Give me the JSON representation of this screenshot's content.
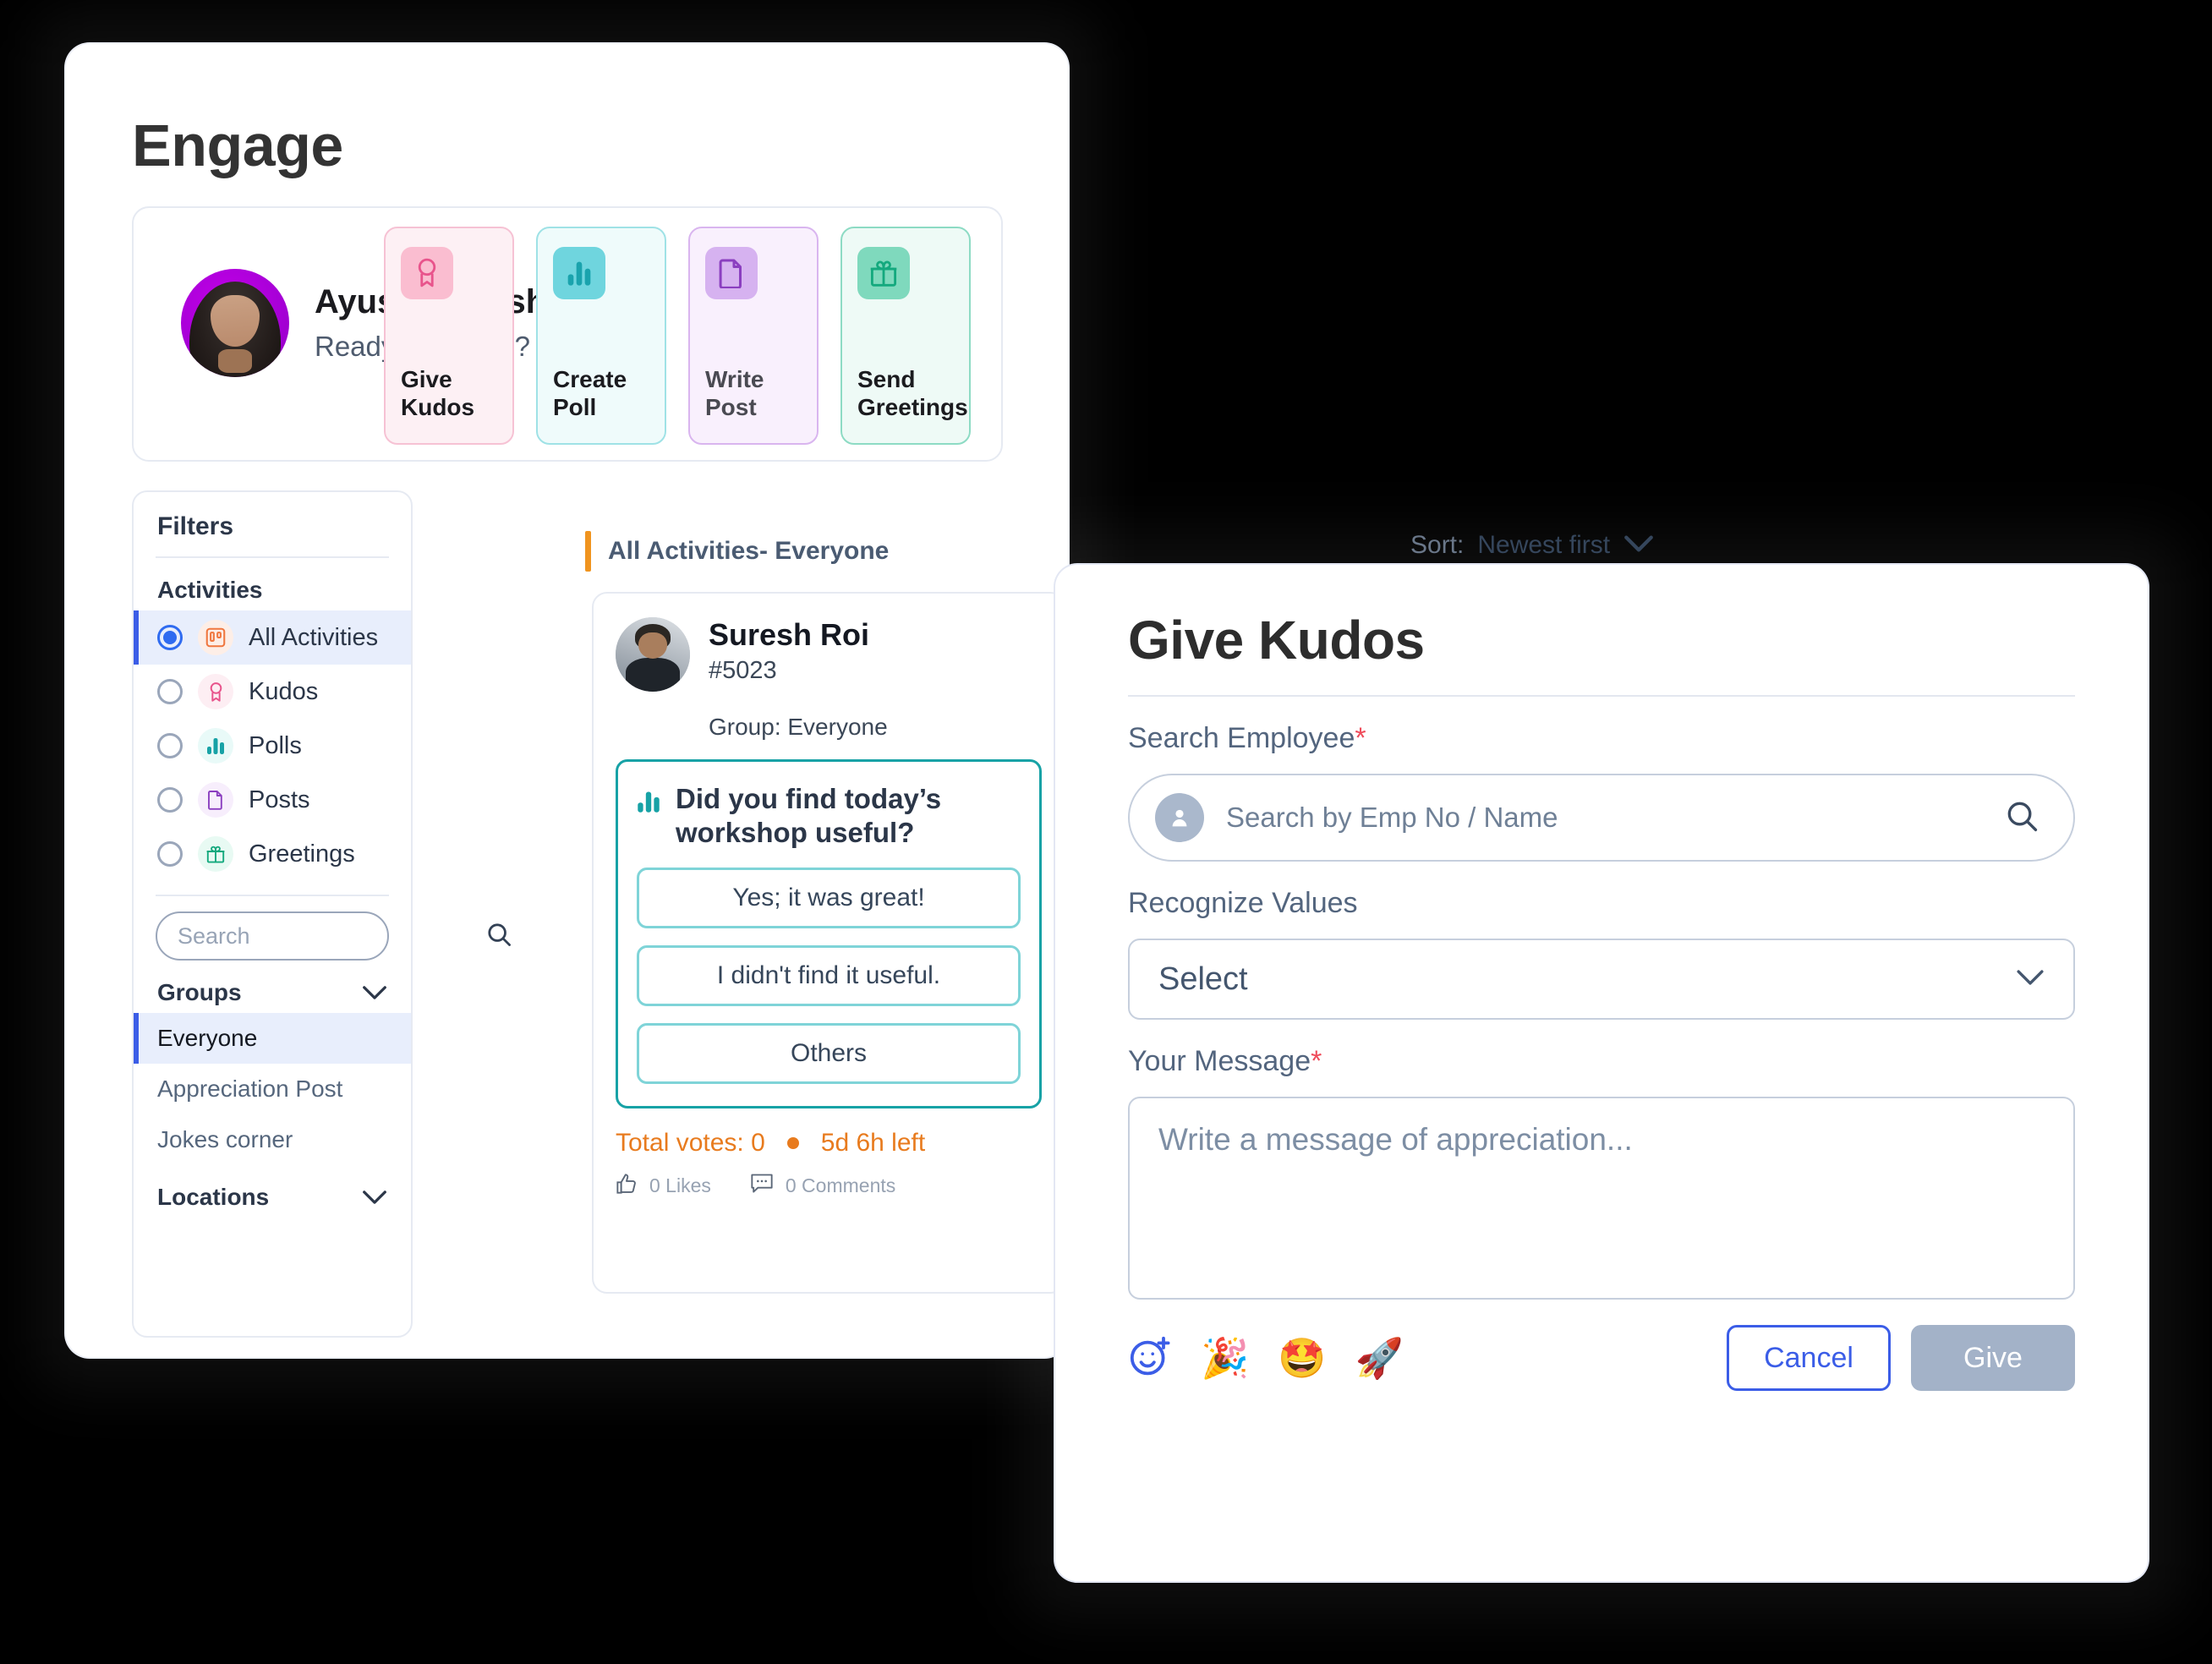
{
  "page": {
    "title": "Engage"
  },
  "profile": {
    "name": "Ayushi Rajesh dorle",
    "tagline": "Ready to dive in?"
  },
  "quick_actions": [
    {
      "label": "Give\nKudos",
      "icon": "ribbon-award-icon",
      "accent": "#e8548c"
    },
    {
      "label": "Create\nPoll",
      "icon": "bar-chart-icon",
      "accent": "#1aa3ad"
    },
    {
      "label": "Write\nPost",
      "icon": "document-icon",
      "accent": "#8b3fc0"
    },
    {
      "label": "Send\nGreetings",
      "icon": "gift-icon",
      "accent": "#14a97e"
    }
  ],
  "filters": {
    "title": "Filters",
    "activities_heading": "Activities",
    "activities": [
      {
        "label": "All Activities",
        "icon": "board-icon",
        "selected": true
      },
      {
        "label": "Kudos",
        "icon": "ribbon-award-icon",
        "selected": false
      },
      {
        "label": "Polls",
        "icon": "bar-chart-icon",
        "selected": false
      },
      {
        "label": "Posts",
        "icon": "document-icon",
        "selected": false
      },
      {
        "label": "Greetings",
        "icon": "gift-icon",
        "selected": false
      }
    ],
    "search": {
      "value": "",
      "placeholder": "Search"
    },
    "groups_heading": "Groups",
    "groups": [
      {
        "label": "Everyone",
        "selected": true
      },
      {
        "label": "Appreciation Post",
        "selected": false
      },
      {
        "label": "Jokes corner",
        "selected": false
      }
    ],
    "locations_heading": "Locations"
  },
  "feed": {
    "heading": "All Activities- Everyone",
    "sort": {
      "label": "Sort:",
      "value": "Newest first"
    },
    "post": {
      "author": "Suresh Roi",
      "employee_id": "#5023",
      "group": "Group: Everyone",
      "poll": {
        "question": "Did you find today’s workshop useful?",
        "options": [
          "Yes; it was great!",
          "I didn't find it useful.",
          "Others"
        ],
        "total_votes": "Total votes: 0",
        "time_left": "5d 6h left"
      },
      "likes": "0 Likes",
      "comments": "0 Comments"
    }
  },
  "modal": {
    "title": "Give Kudos",
    "search_employee_label": "Search Employee",
    "search_employee": {
      "value": "",
      "placeholder": "Search by Emp No / Name"
    },
    "recognize_values_label": "Recognize Values",
    "recognize_values": {
      "value": "Select"
    },
    "your_message_label": "Your Message",
    "message": {
      "value": "",
      "placeholder": "Write a message of appreciation..."
    },
    "emojis": [
      "🎉",
      "🤩",
      "🚀"
    ],
    "cancel_label": "Cancel",
    "give_label": "Give",
    "required_mark": "*"
  },
  "colors": {
    "accent_blue": "#3b5de7",
    "orange": "#e87b1e",
    "teal": "#17a2a6",
    "pink": "#e8548c",
    "purple": "#8b3fc0",
    "green": "#14a97e"
  }
}
